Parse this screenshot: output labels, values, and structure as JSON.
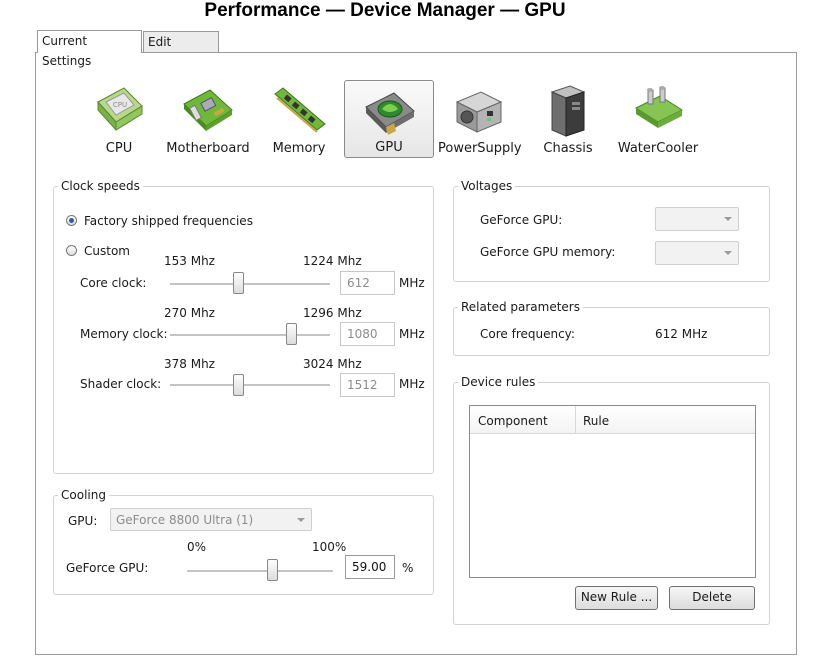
{
  "window_title": "Performance — Device Manager — GPU",
  "tabs": [
    {
      "label": "Current Settings",
      "active": true
    },
    {
      "label": "Edit Profiles",
      "active": false
    }
  ],
  "devices": [
    {
      "label": "CPU",
      "icon": "cpu-icon",
      "chip_text": "CPU"
    },
    {
      "label": "Motherboard",
      "icon": "motherboard-icon"
    },
    {
      "label": "Memory",
      "icon": "memory-icon"
    },
    {
      "label": "GPU",
      "icon": "gpu-icon",
      "selected": true
    },
    {
      "label": "PowerSupply",
      "icon": "powersupply-icon"
    },
    {
      "label": "Chassis",
      "icon": "chassis-icon"
    },
    {
      "label": "WaterCooler",
      "icon": "watercooler-icon"
    }
  ],
  "clock_speeds": {
    "title": "Clock speeds",
    "radio_factory": "Factory shipped frequencies",
    "radio_custom": "Custom",
    "selected": "factory",
    "unit": "MHz",
    "sliders": [
      {
        "label": "Core clock:",
        "min": "153 Mhz",
        "max": "1224 Mhz",
        "value": "612",
        "fraction": 0.43
      },
      {
        "label": "Memory clock:",
        "min": "270 Mhz",
        "max": "1296 Mhz",
        "value": "1080",
        "fraction": 0.77
      },
      {
        "label": "Shader clock:",
        "min": "378 Mhz",
        "max": "3024 Mhz",
        "value": "1512",
        "fraction": 0.43
      }
    ]
  },
  "cooling": {
    "title": "Cooling",
    "gpu_label": "GPU:",
    "gpu_selected": "GeForce 8800 Ultra (1)",
    "min": "0%",
    "max": "100%",
    "slider_label": "GeForce GPU:",
    "value": "59.00",
    "unit": "%",
    "fraction": 0.59
  },
  "voltages": {
    "title": "Voltages",
    "rows": [
      {
        "label": "GeForce GPU:",
        "value": ""
      },
      {
        "label": "GeForce GPU memory:",
        "value": ""
      }
    ]
  },
  "related": {
    "title": "Related parameters",
    "label": "Core frequency:",
    "value": "612 MHz"
  },
  "device_rules": {
    "title": "Device rules",
    "columns": [
      "Component",
      "Rule"
    ],
    "rows": [],
    "new_rule_label": "New Rule ...",
    "delete_label": "Delete"
  }
}
